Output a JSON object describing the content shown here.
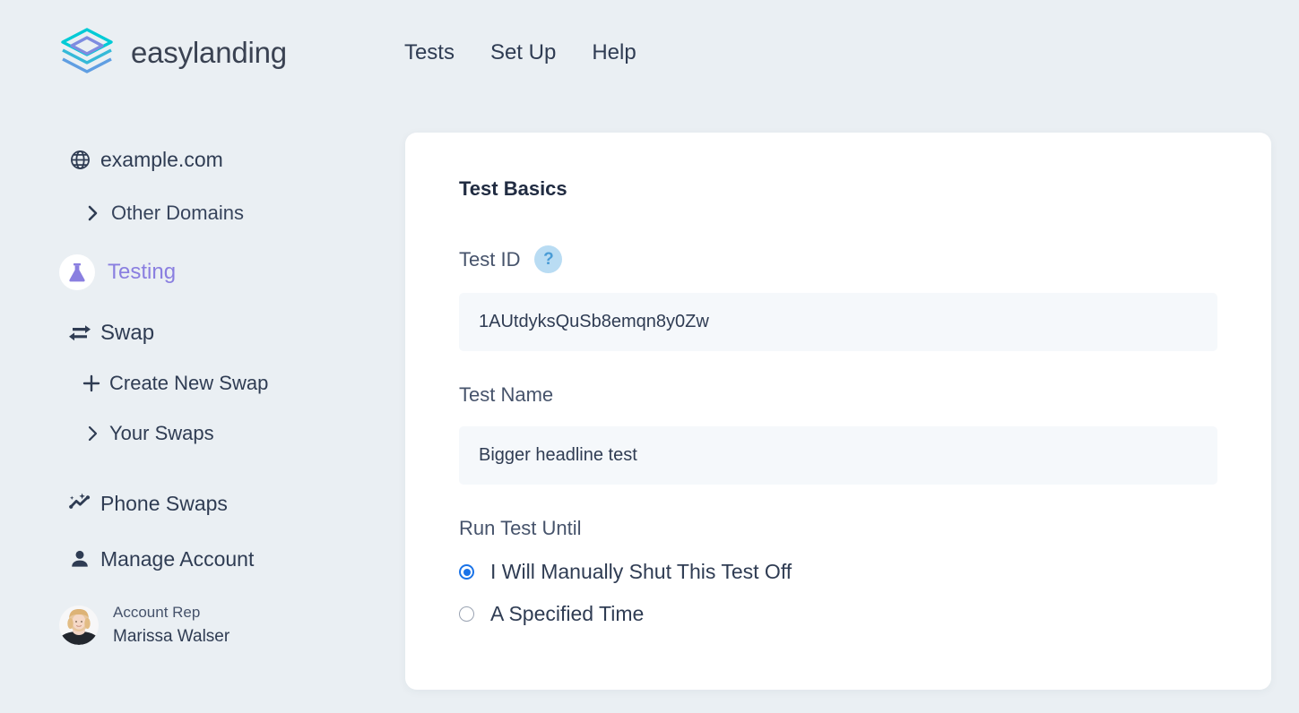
{
  "brand": {
    "name": "easylanding",
    "logo_icon": "layered-diamond-logo",
    "colors": {
      "cyan": "#00cbd6",
      "blue": "#49a8dd",
      "purple": "#8a7fe0"
    }
  },
  "topnav": {
    "items": [
      {
        "label": "Tests",
        "name": "nav-tests"
      },
      {
        "label": "Set Up",
        "name": "nav-setup"
      },
      {
        "label": "Help",
        "name": "nav-help"
      }
    ]
  },
  "sidebar": {
    "domain": {
      "label": "example.com",
      "icon": "globe-icon"
    },
    "other_domains": {
      "label": "Other Domains",
      "icon": "chevron-right-icon"
    },
    "testing": {
      "label": "Testing",
      "icon": "flask-icon",
      "active": true,
      "color": "#8a7fe0"
    },
    "swap": {
      "label": "Swap",
      "icon": "swap-arrows-icon"
    },
    "create_new_swap": {
      "label": "Create New Swap",
      "icon": "plus-icon"
    },
    "your_swaps": {
      "label": "Your Swaps",
      "icon": "chevron-right-icon"
    },
    "phone_swaps": {
      "label": "Phone Swaps",
      "icon": "sparkle-trend-icon"
    },
    "manage_account": {
      "label": "Manage Account",
      "icon": "person-icon"
    },
    "account_rep": {
      "role": "Account Rep",
      "name": "Marissa Walser",
      "avatar_icon": "user-avatar-photo"
    }
  },
  "main": {
    "section_title": "Test Basics",
    "test_id": {
      "label": "Test ID",
      "help_glyph": "?",
      "value": "1AUtdyksQuSb8emqn8y0Zw",
      "placeholder": "Test ID"
    },
    "test_name": {
      "label": "Test Name",
      "value": "Bigger headline test",
      "placeholder": "Test Name"
    },
    "run_test_until": {
      "label": "Run Test Until",
      "options": [
        {
          "label": "I Will Manually Shut This Test Off",
          "selected": true
        },
        {
          "label": "A Specified Time",
          "selected": false
        }
      ]
    }
  }
}
